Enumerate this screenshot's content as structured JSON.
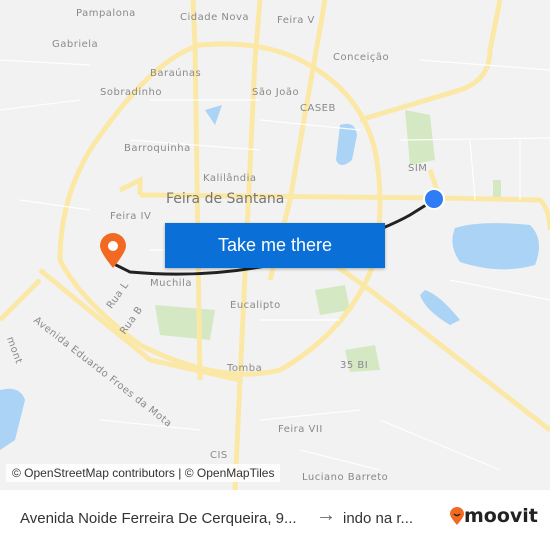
{
  "map": {
    "labels": [
      "Pampalona",
      "Cidade Nova",
      "Feira V",
      "Gabriela",
      "Conceição",
      "Baraúnas",
      "Sobradinho",
      "São João",
      "CASEB",
      "Barroquinha",
      "SIM",
      "Kalilândia",
      "Feira IV",
      "Muchila",
      "Eucalipto",
      "Tomba",
      "35 BI",
      "Feira VII",
      "CIS",
      "Rua L",
      "Rua B",
      "Avenida Eduardo Froes da Mota",
      "mont",
      "Luciano Barreto"
    ],
    "city_label": "Feira de Santana",
    "colors": {
      "road": "#fbe8a6",
      "water": "#aad3f5",
      "park": "#d5e8c4",
      "route": "#222222",
      "origin": "#2e7cf6",
      "destination": "#f26a21"
    }
  },
  "cta": {
    "label": "Take me there"
  },
  "attribution": "© OpenStreetMap contributors | © OpenMapTiles",
  "footer": {
    "from": "Avenida Noide Ferreira De Cerqueira, 9...",
    "arrow": "→",
    "to": "indo na r...",
    "brand": "moovit"
  }
}
